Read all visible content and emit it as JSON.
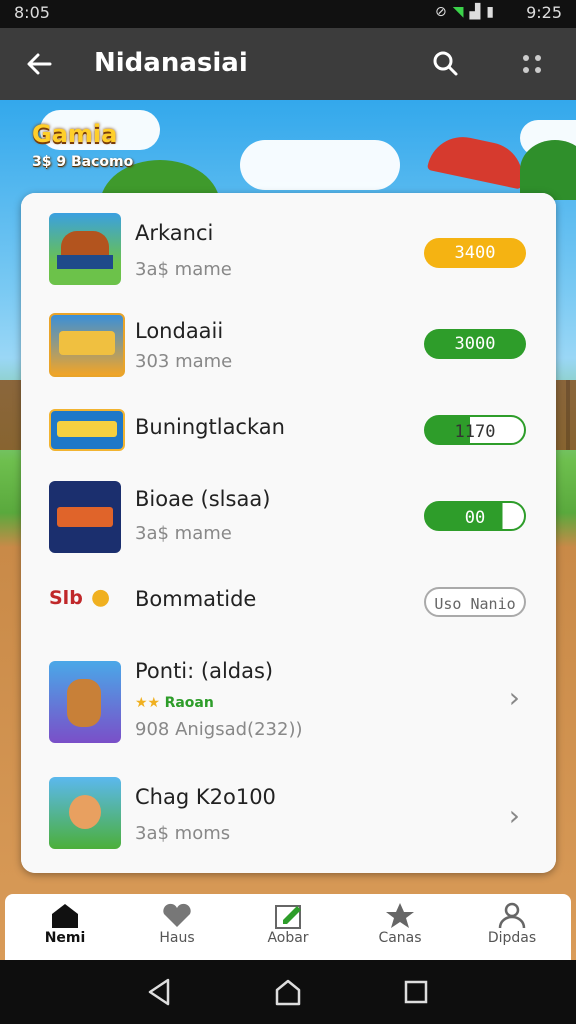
{
  "status_bar": {
    "time": "8:05",
    "clock": "9:25"
  },
  "app_bar": {
    "title": "Nidanasiai"
  },
  "banner": {
    "logo_text": "Gamia",
    "logo_sub": "3$ 9 Bacomo"
  },
  "games": [
    {
      "title": "Arkanci",
      "subtitle": "3a$ mame",
      "badge": "3400",
      "badge_style": "yellow"
    },
    {
      "title": "Londaaii",
      "subtitle": "303 mame",
      "badge": "3000",
      "badge_style": "green"
    },
    {
      "title": "Buningtlackan",
      "subtitle": "",
      "badge": "1170",
      "badge_style": "green-partial"
    },
    {
      "title": "Bioae (slsaa)",
      "subtitle": "3a$ mame",
      "badge": "00",
      "badge_style": "green-partial"
    },
    {
      "title": "Bommatide",
      "subtitle": "",
      "badge": "Uso Nanio",
      "badge_style": "outline",
      "prefix": "Slb"
    },
    {
      "title": "Ponti: (aldas)",
      "subtitle": "908 Anigsad(232))",
      "rating_text": "Raoan",
      "chevron": true
    },
    {
      "title": "Chag K2o100",
      "subtitle": "3a$ moms",
      "chevron": true
    }
  ],
  "bottom_nav": [
    {
      "label": "Nemi",
      "icon": "home-icon",
      "active": true
    },
    {
      "label": "Haus",
      "icon": "heart-icon",
      "active": false
    },
    {
      "label": "Aobar",
      "icon": "edit-icon",
      "active": false
    },
    {
      "label": "Canas",
      "icon": "star-icon",
      "active": false
    },
    {
      "label": "Dipdas",
      "icon": "person-icon",
      "active": false
    }
  ],
  "colors": {
    "accent_green": "#2e9d2a",
    "badge_yellow": "#f5b312",
    "app_bar": "#3c3c3c"
  }
}
